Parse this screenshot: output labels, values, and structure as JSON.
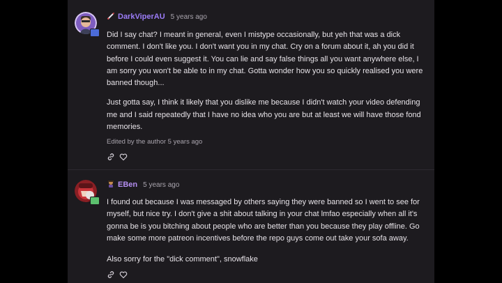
{
  "comments": [
    {
      "username": "DarkViperAU",
      "time": "5 years ago",
      "paragraphs": [
        "Did I say chat? I meant in general, even I mistype occasionally, but yeh that was a dick comment. I don't like you. I don't want you in my chat. Cry on a forum about it, ah you did it before I could even suggest it. You can lie and say false things all you want anywhere else, I am sorry you won't be able to in my chat. Gotta wonder how you so quickly realised you were banned though...",
        "Just gotta say, I think it likely that you dislike me because I didn't watch your video defending me and I said repeatedly that I have no idea who you are but at least we will have those fond memories."
      ],
      "edited": "Edited by the author 5 years ago",
      "name_color": "#9b7cf7",
      "flair_icon": "rocket-icon"
    },
    {
      "username": "EBen",
      "time": "5 years ago",
      "paragraphs": [
        "I found out because I was messaged by others saying they were banned so I went to see for myself, but nice try. I don't give a shit about talking in your chat lmfao especially when all it's gonna be is you bitching about people who are better than you because they play offline. Go make some more patreon incentives before the repo guys come out take your sofa away.",
        "Also sorry for the \"dick comment\", snowflake"
      ],
      "name_color": "#b48ef0",
      "flair_icon": "character-icon"
    }
  ],
  "colors": {
    "background": "#1d1b1f",
    "text": "#e7e3e8",
    "muted": "#a9a4ad"
  }
}
